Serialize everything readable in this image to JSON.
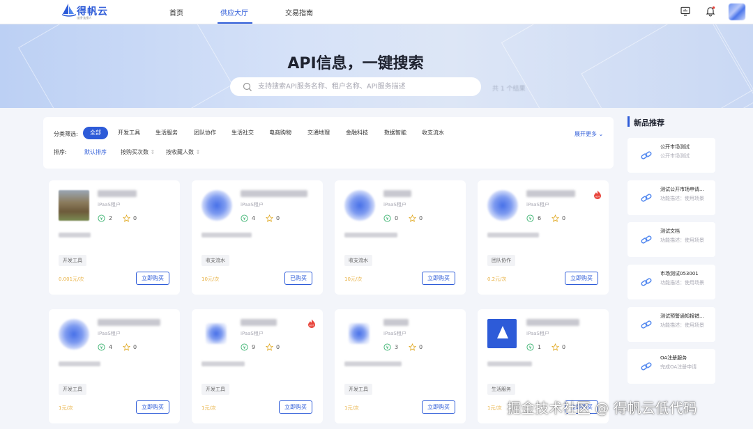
{
  "header": {
    "logo_text": "得帆云",
    "logo_tagline": "连接·连接人",
    "nav": [
      "首页",
      "供应大厅",
      "交易指南"
    ],
    "active_nav": "供应大厅"
  },
  "banner": {
    "title": "API信息，一键搜索",
    "search_placeholder": "支持搜索API服务名称、租户名称、API服务描述",
    "result_count": "共 1 个结果"
  },
  "filters": {
    "category_label": "分类筛选:",
    "categories": [
      "全部",
      "开发工具",
      "生活服务",
      "团队协作",
      "生活社交",
      "电商购物",
      "交通地理",
      "金融科技",
      "数据智能",
      "收支流水"
    ],
    "active_category": "全部",
    "expand_more": "展开更多",
    "sort_label": "排序:",
    "sorts": [
      "默认排序",
      "按购买次数",
      "按收藏人数"
    ],
    "active_sort": "默认排序"
  },
  "products": [
    {
      "tenant": "iPaaS租户",
      "buys": "2",
      "stars": "0",
      "tag": "开发工具",
      "price": "0.001元/次",
      "button": "立即购买",
      "thumb": "photo",
      "hot": false
    },
    {
      "tenant": "iPaaS租户",
      "buys": "4",
      "stars": "0",
      "tag": "收支流水",
      "price": "10元/次",
      "button": "已购买",
      "thumb": "blue",
      "hot": false
    },
    {
      "tenant": "iPaaS租户",
      "buys": "0",
      "stars": "0",
      "tag": "收支流水",
      "price": "10元/次",
      "button": "立即购买",
      "thumb": "blue",
      "hot": false
    },
    {
      "tenant": "iPaaS租户",
      "buys": "6",
      "stars": "0",
      "tag": "团队协作",
      "price": "0.2元/次",
      "button": "立即购买",
      "thumb": "blue",
      "hot": true
    },
    {
      "tenant": "iPaaS租户",
      "buys": "4",
      "stars": "0",
      "tag": "开发工具",
      "price": "1元/次",
      "button": "立即购买",
      "thumb": "blue",
      "hot": false
    },
    {
      "tenant": "iPaaS租户",
      "buys": "9",
      "stars": "0",
      "tag": "开发工具",
      "price": "1元/次",
      "button": "立即购买",
      "thumb": "blue",
      "hot": true
    },
    {
      "tenant": "iPaaS租户",
      "buys": "3",
      "stars": "0",
      "tag": "开发工具",
      "price": "1元/次",
      "button": "立即购买",
      "thumb": "blue",
      "hot": false
    },
    {
      "tenant": "iPaaS租户",
      "buys": "1",
      "stars": "0",
      "tag": "生活服务",
      "price": "1元/次",
      "button": "立即购买",
      "thumb": "logo",
      "hot": false
    }
  ],
  "new_products": {
    "title": "新品推荐",
    "items": [
      {
        "name": "公开市场测试",
        "desc": "公开市场测试"
      },
      {
        "name": "测试公开市场申请...",
        "desc": "功能描述：使用场景"
      },
      {
        "name": "测试文档",
        "desc": "功能描述：使用场景"
      },
      {
        "name": "市场测试053001",
        "desc": "功能描述：使用场景"
      },
      {
        "name": "测试预警通知报错...",
        "desc": "功能描述：使用场景"
      },
      {
        "name": "OA注册服务",
        "desc": "完成OA注册申请"
      }
    ]
  },
  "watermark": "掘金技术社区 @ 得帆云低代码",
  "colors": {
    "accent": "#2d5bd8",
    "price": "#e8b040",
    "hot": "#e8453c"
  }
}
